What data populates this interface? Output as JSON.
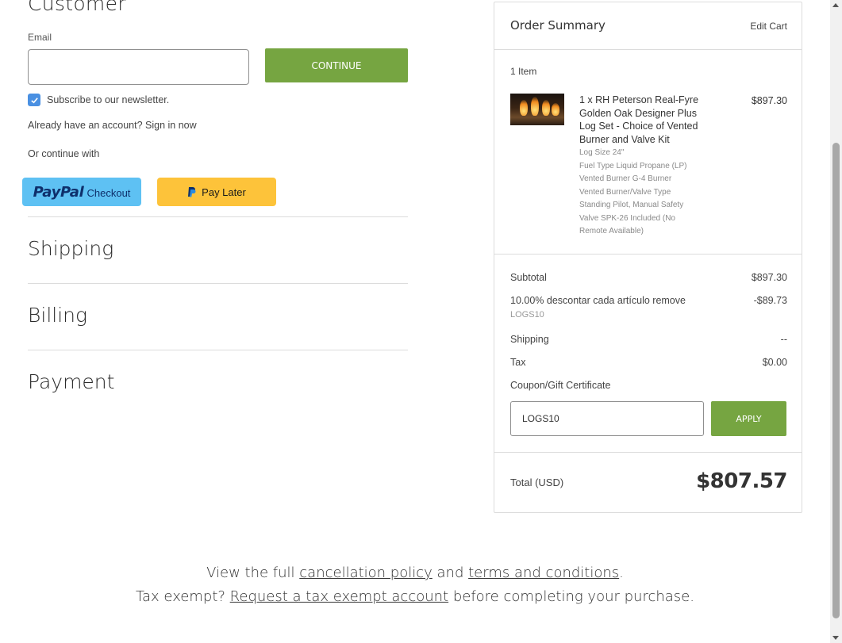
{
  "customer": {
    "title": "Customer",
    "email_label": "Email",
    "email_value": "",
    "continue_label": "CONTINUE",
    "newsletter_label": "Subscribe to our newsletter.",
    "newsletter_checked": true,
    "already_account": "Already have an account? Sign in now",
    "or_continue": "Or continue with",
    "paypal_word": "PayPal",
    "paypal_checkout": "Checkout",
    "pay_later": "Pay Later"
  },
  "sections": {
    "shipping": "Shipping",
    "billing": "Billing",
    "payment": "Payment"
  },
  "summary": {
    "title": "Order Summary",
    "edit_cart": "Edit Cart",
    "item_count": "1 Item",
    "item": {
      "name": "1 x RH Peterson Real-Fyre Golden Oak Designer Plus Log Set - Choice of Vented Burner and Valve Kit",
      "price": "$897.30",
      "options": [
        "Log Size 24\"",
        "Fuel Type Liquid Propane (LP)",
        "Vented Burner G-4 Burner",
        "Vented Burner/Valve Type",
        "Standing Pilot, Manual Safety",
        "Valve SPK-26 Included (No",
        "Remote Available)"
      ]
    },
    "subtotal_label": "Subtotal",
    "subtotal_value": "$897.30",
    "discount_label": "10.00% descontar cada artículo remove",
    "discount_value": "-$89.73",
    "discount_code": "LOGS10",
    "shipping_label": "Shipping",
    "shipping_value": "--",
    "tax_label": "Tax",
    "tax_value": "$0.00",
    "coupon_label": "Coupon/Gift Certificate",
    "coupon_value": "LOGS10",
    "apply_label": "APPLY",
    "total_label": "Total (USD)",
    "total_value": "$807.57"
  },
  "footer": {
    "line1_pre": "View the full ",
    "cancellation_link": "cancellation policy",
    "line1_mid": " and ",
    "terms_link": "terms and conditions",
    "line1_post": ".",
    "line2_pre": "Tax exempt? ",
    "tax_exempt_link": "Request a tax exempt account",
    "line2_post": " before completing your purchase."
  },
  "colors": {
    "accent_green": "#76a541",
    "checkbox_blue": "#4a90e2",
    "paypal_blue": "#5ec1f3",
    "paylater_yellow": "#fdc33a"
  }
}
